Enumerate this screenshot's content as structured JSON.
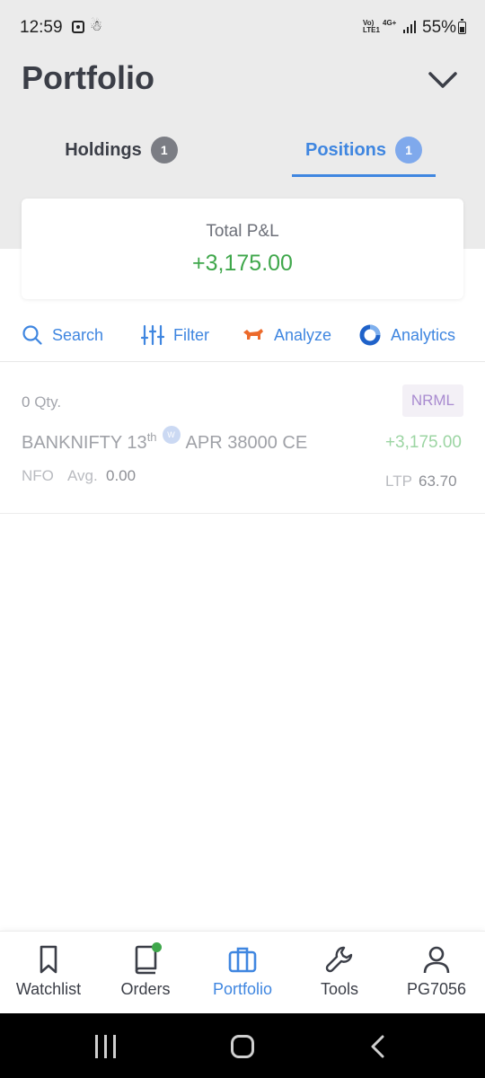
{
  "status_bar": {
    "time": "12:59",
    "network_1": "Vo) LTE1",
    "network_2": "4G+",
    "battery": "55%"
  },
  "header": {
    "title": "Portfolio",
    "tabs": [
      {
        "label": "Holdings",
        "count": "1",
        "active": false
      },
      {
        "label": "Positions",
        "count": "1",
        "active": true
      }
    ]
  },
  "summary": {
    "label": "Total P&L",
    "value": "+3,175.00"
  },
  "toolbar": {
    "search": "Search",
    "filter": "Filter",
    "analyze": "Analyze",
    "analytics": "Analytics"
  },
  "positions": [
    {
      "qty_value": "0",
      "qty_label": "Qty.",
      "symbol_pre": "BANKNIFTY 13",
      "symbol_sup": "th",
      "weekly_badge": "W",
      "symbol_post": "APR 38000 CE",
      "product": "NRML",
      "pnl": "+3,175.00",
      "exchange": "NFO",
      "avg_label": "Avg.",
      "avg_value": "0.00",
      "ltp_label": "LTP",
      "ltp_value": "63.70"
    }
  ],
  "bottom_nav": [
    {
      "label": "Watchlist",
      "icon": "bookmark-icon",
      "active": false
    },
    {
      "label": "Orders",
      "icon": "book-icon",
      "active": false
    },
    {
      "label": "Portfolio",
      "icon": "briefcase-icon",
      "active": true
    },
    {
      "label": "Tools",
      "icon": "wrench-icon",
      "active": false
    },
    {
      "label": "PG7056",
      "icon": "user-icon",
      "active": false
    }
  ],
  "colors": {
    "accent": "#3f86e0",
    "profit": "#3fa74b",
    "header_bg": "#ebebeb"
  }
}
